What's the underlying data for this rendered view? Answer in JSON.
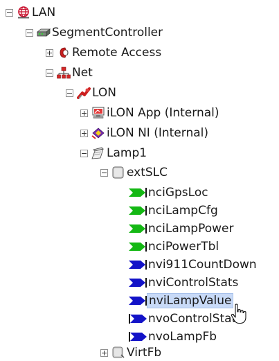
{
  "tree": {
    "lan": "LAN",
    "segment_controller": "SegmentController",
    "remote_access": "Remote Access",
    "net": "Net",
    "lon": "LON",
    "ilon_app": "iLON App (Internal)",
    "ilon_ni": "iLON NI (Internal)",
    "lamp1": "Lamp1",
    "extslc": "extSLC",
    "datapoints": [
      {
        "label": "nciGpsLoc",
        "kind": "nci"
      },
      {
        "label": "nciLampCfg",
        "kind": "nci"
      },
      {
        "label": "nciLampPower",
        "kind": "nci"
      },
      {
        "label": "nciPowerTbl",
        "kind": "nci"
      },
      {
        "label": "nvi911CountDown",
        "kind": "nvi"
      },
      {
        "label": "nviControlStats",
        "kind": "nvi"
      },
      {
        "label": "nviLampValue",
        "kind": "nvi",
        "selected": true
      },
      {
        "label": "nvoControlStats",
        "kind": "nvo"
      },
      {
        "label": "nvoLampFb",
        "kind": "nvo"
      }
    ],
    "virtfb": "VirtFb"
  },
  "colors": {
    "nci_icon": "#14b814",
    "nv_icon": "#1313c8",
    "selection": "#c8daf7"
  }
}
